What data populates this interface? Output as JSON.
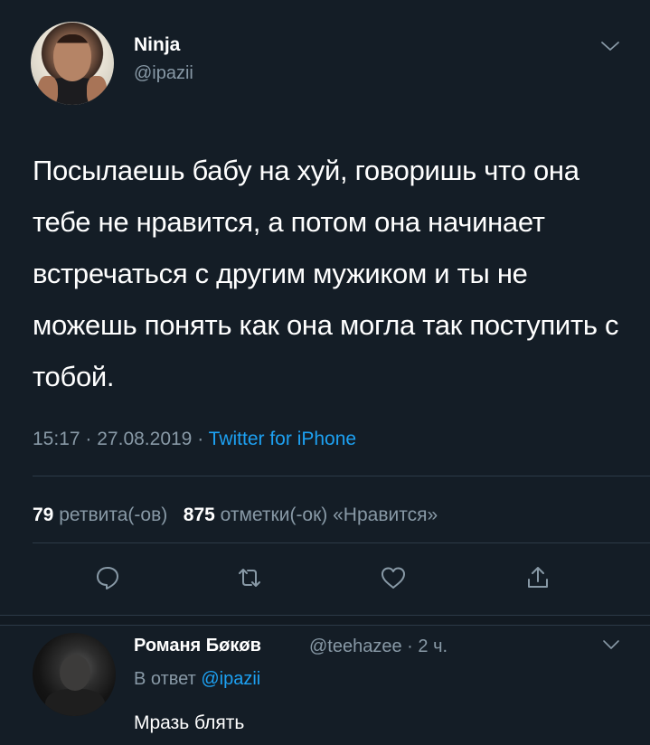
{
  "tweet": {
    "author_name": "Ninja",
    "author_handle": "@ipazii",
    "text": "Посылаешь бабу на хуй, говоришь что она тебе не нравится, а потом она начинает встречаться с другим мужиком и ты не можешь понять как она могла так поступить с тобой.",
    "time": "15:17",
    "date": "27.08.2019",
    "separator": "·",
    "source": "Twitter for iPhone",
    "retweets_count": "79",
    "retweets_label": "ретвита(-ов)",
    "likes_count": "875",
    "likes_label": "отметки(-ок) «Нравится»"
  },
  "actions": {
    "reply_icon": "speech-bubble-icon",
    "retweet_icon": "retweet-icon",
    "like_icon": "heart-icon",
    "share_icon": "share-icon"
  },
  "reply": {
    "author_name": "Романя Бøкøв",
    "author_handle": "@teehazee",
    "time": "2 ч.",
    "separator": "·",
    "reply_to_label": "В ответ",
    "reply_to_handle": "@ipazii",
    "text": "Мразь блять"
  },
  "colors": {
    "background": "#141d26",
    "text_primary": "#ffffff",
    "text_secondary": "#8899a6",
    "accent": "#1da1f2",
    "divider": "#2c3a47"
  }
}
